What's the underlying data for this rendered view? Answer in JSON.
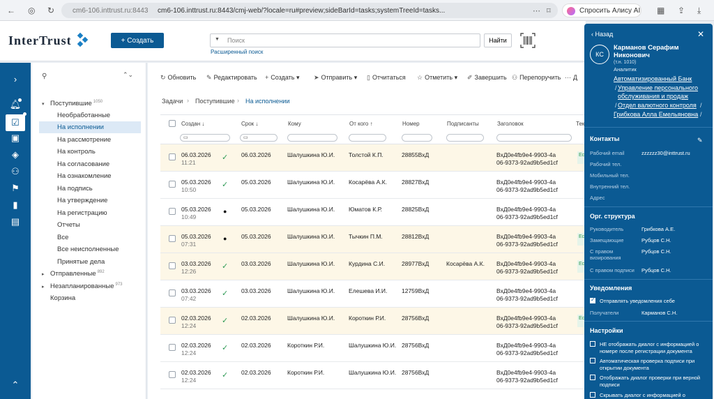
{
  "browser": {
    "url_host": "cm6-106.inttrust.ru:8443",
    "url_full": "cm6-106.inttrust.ru:8443/cmj-web/?locale=ru#preview;sideBarId=tasks;systemTreeId=tasks...",
    "alice_label": "Спросить Алису AI"
  },
  "header": {
    "logo": "InterTrust",
    "create_label": "Создать",
    "create_plus": "+",
    "search_placeholder": "Поиск",
    "find_label": "Найти",
    "advanced_search": "Расширенный поиск"
  },
  "tree": {
    "items": [
      {
        "label": "Поступившие",
        "count": "1050",
        "expander": "▾"
      },
      {
        "label": "Необработанные"
      },
      {
        "label": "На исполнении"
      },
      {
        "label": "На рассмотрение"
      },
      {
        "label": "На контроль"
      },
      {
        "label": "На согласование"
      },
      {
        "label": "На ознакомление"
      },
      {
        "label": "На подпись"
      },
      {
        "label": "На утверждение"
      },
      {
        "label": "На регистрацию"
      },
      {
        "label": "Отчеты"
      },
      {
        "label": "Все"
      },
      {
        "label": "Все неисполненные"
      },
      {
        "label": "Принятые дела"
      },
      {
        "label": "Отправленные",
        "count": "892",
        "expander": "▸"
      },
      {
        "label": "Незапланированные",
        "count": "973",
        "expander": "▸"
      },
      {
        "label": "Корзина"
      }
    ]
  },
  "toolbar": {
    "refresh": "Обновить",
    "edit": "Редактировать",
    "create": "Создать",
    "send": "Отправить",
    "report": "Отчитаться",
    "mark": "Отметить",
    "finish": "Завершить",
    "reassign": "Перепоручить",
    "more": "Д"
  },
  "breadcrumbs": [
    "Задачи",
    "Поступившие",
    "На исполнении"
  ],
  "grid": {
    "columns": {
      "created": "Создан ↓",
      "due": "Срок ↓",
      "to": "Кому",
      "from": "От кого ↑",
      "number": "Номер",
      "signers": "Подписанты",
      "subject": "Заголовок",
      "more": "Тек"
    },
    "rows": [
      {
        "date": "06.03.2026",
        "time": "11:21",
        "state": "check",
        "due": "06.03.2026",
        "to": "Шалушкина Ю.И.",
        "from": "Толстой К.П.",
        "number": "28855ВхД",
        "signers": "",
        "subj1": "ВхД0e4fb9e4-9903-4a",
        "subj2": "06-9373-92ad9b5ed1cf",
        "hl": true,
        "tag": "Ес"
      },
      {
        "date": "05.03.2026",
        "time": "10:50",
        "state": "check",
        "due": "05.03.2026",
        "to": "Шалушкина Ю.И.",
        "from": "Косарёва А.К.",
        "number": "28827ВхД",
        "signers": "",
        "subj1": "ВхД0e4fb9e4-9903-4a",
        "subj2": "06-9373-92ad9b5ed1cf",
        "hl": false,
        "tag": ""
      },
      {
        "date": "05.03.2026",
        "time": "10:49",
        "state": "dot",
        "due": "05.03.2026",
        "to": "Шалушкина Ю.И.",
        "from": "Юматов К.Р.",
        "number": "28825ВхД",
        "signers": "",
        "subj1": "ВхД0e4fb9e4-9903-4a",
        "subj2": "06-9373-92ad9b5ed1cf",
        "hl": false,
        "tag": ""
      },
      {
        "date": "05.03.2026",
        "time": "07:31",
        "state": "dot",
        "due": "05.03.2026",
        "to": "Шалушкина Ю.И.",
        "from": "Тычкин П.М.",
        "number": "28812ВхД",
        "signers": "",
        "subj1": "ВхД0e4fb9e4-9903-4a",
        "subj2": "06-9373-92ad9b5ed1cf",
        "hl": true,
        "tag": "Ес"
      },
      {
        "date": "03.03.2026",
        "time": "12:26",
        "state": "check",
        "due": "03.03.2026",
        "to": "Шалушкина Ю.И.",
        "from": "Курдина С.И.",
        "number": "28977ВхД",
        "signers": "Косарёва А.К.",
        "subj1": "ВхД0e4fb9e4-9903-4a",
        "subj2": "06-9373-92ad9b5ed1cf",
        "hl": true,
        "tag": "Ес"
      },
      {
        "date": "03.03.2026",
        "time": "07:42",
        "state": "check",
        "due": "03.03.2026",
        "to": "Шалушкина Ю.И.",
        "from": "Елешева И.И.",
        "number": "12759ВхД",
        "signers": "",
        "subj1": "ВхД0e4fb9e4-9903-4a",
        "subj2": "06-9373-92ad9b5ed1cf",
        "hl": false,
        "tag": ""
      },
      {
        "date": "02.03.2026",
        "time": "12:24",
        "state": "check",
        "due": "02.03.2026",
        "to": "Шалушкина Ю.И.",
        "from": "Короткин Р.И.",
        "number": "28756ВхД",
        "signers": "",
        "subj1": "ВхД0e4fb9e4-9903-4a",
        "subj2": "06-9373-92ad9b5ed1cf",
        "hl": true,
        "tag": "Ес"
      },
      {
        "date": "02.03.2026",
        "time": "12:24",
        "state": "check",
        "due": "02.03.2026",
        "to": "Короткин Р.И.",
        "from": "Шалушкина Ю.И.",
        "number": "28756ВхД",
        "signers": "",
        "subj1": "ВхД0e4fb9e4-9903-4a",
        "subj2": "06-9373-92ad9b5ed1cf",
        "hl": false,
        "tag": ""
      },
      {
        "date": "02.03.2026",
        "time": "12:24",
        "state": "check",
        "due": "02.03.2026",
        "to": "Короткин Р.И.",
        "from": "Шалушкина Ю.И.",
        "number": "28756ВхД",
        "signers": "",
        "subj1": "ВхД0e4fb9e4-9903-4a",
        "subj2": "06-9373-92ad9b5ed1cf",
        "hl": false,
        "tag": ""
      }
    ]
  },
  "panel": {
    "back": "‹ Назад",
    "initials": "КС",
    "name": "Карманов Серафим Никонович",
    "number": "(т.н. 1010)",
    "role": "Аналитик",
    "org_links": [
      "Автоматизированный Банк",
      "Управление персонального",
      "обслуживания и продаж",
      "Отдел валютного контроля",
      "Грибкова Алла Емельяновна"
    ],
    "contacts_title": "Контакты",
    "contacts": [
      {
        "label": "Рабочий email",
        "value": "zzzzzz30@inttrust.ru"
      },
      {
        "label": "Рабочий тел.",
        "value": ""
      },
      {
        "label": "Мобильный тел.",
        "value": ""
      },
      {
        "label": "Внутренний тел.",
        "value": ""
      },
      {
        "label": "Адрес",
        "value": ""
      }
    ],
    "org_title": "Орг. структура",
    "org": [
      {
        "label": "Руководитель",
        "value": "Грибкова А.Е."
      },
      {
        "label": "Замещающие",
        "value": "Рубцов С.Н."
      },
      {
        "label": "С правом визирования",
        "value": "Рубцов С.Н."
      },
      {
        "label": "С правом подписи",
        "value": "Рубцов С.Н."
      }
    ],
    "notify_title": "Уведомления",
    "notify_send": "Отправлять уведомления себе",
    "recipients_label": "Получатели",
    "recipients_value": "Карманов С.Н.",
    "settings_title": "Настройки",
    "settings": [
      "НЕ отображать диалог с информацией о номере после регистрации документа",
      "Автоматическая проверка подписи при открытии документа",
      "Отображать диалог проверки при верной подписи",
      "Скрывать диалог с информацией о"
    ]
  },
  "colors": {
    "brand": "#0b5a93",
    "highlight_row": "#fdf7e7",
    "ok": "#2e9a55"
  }
}
